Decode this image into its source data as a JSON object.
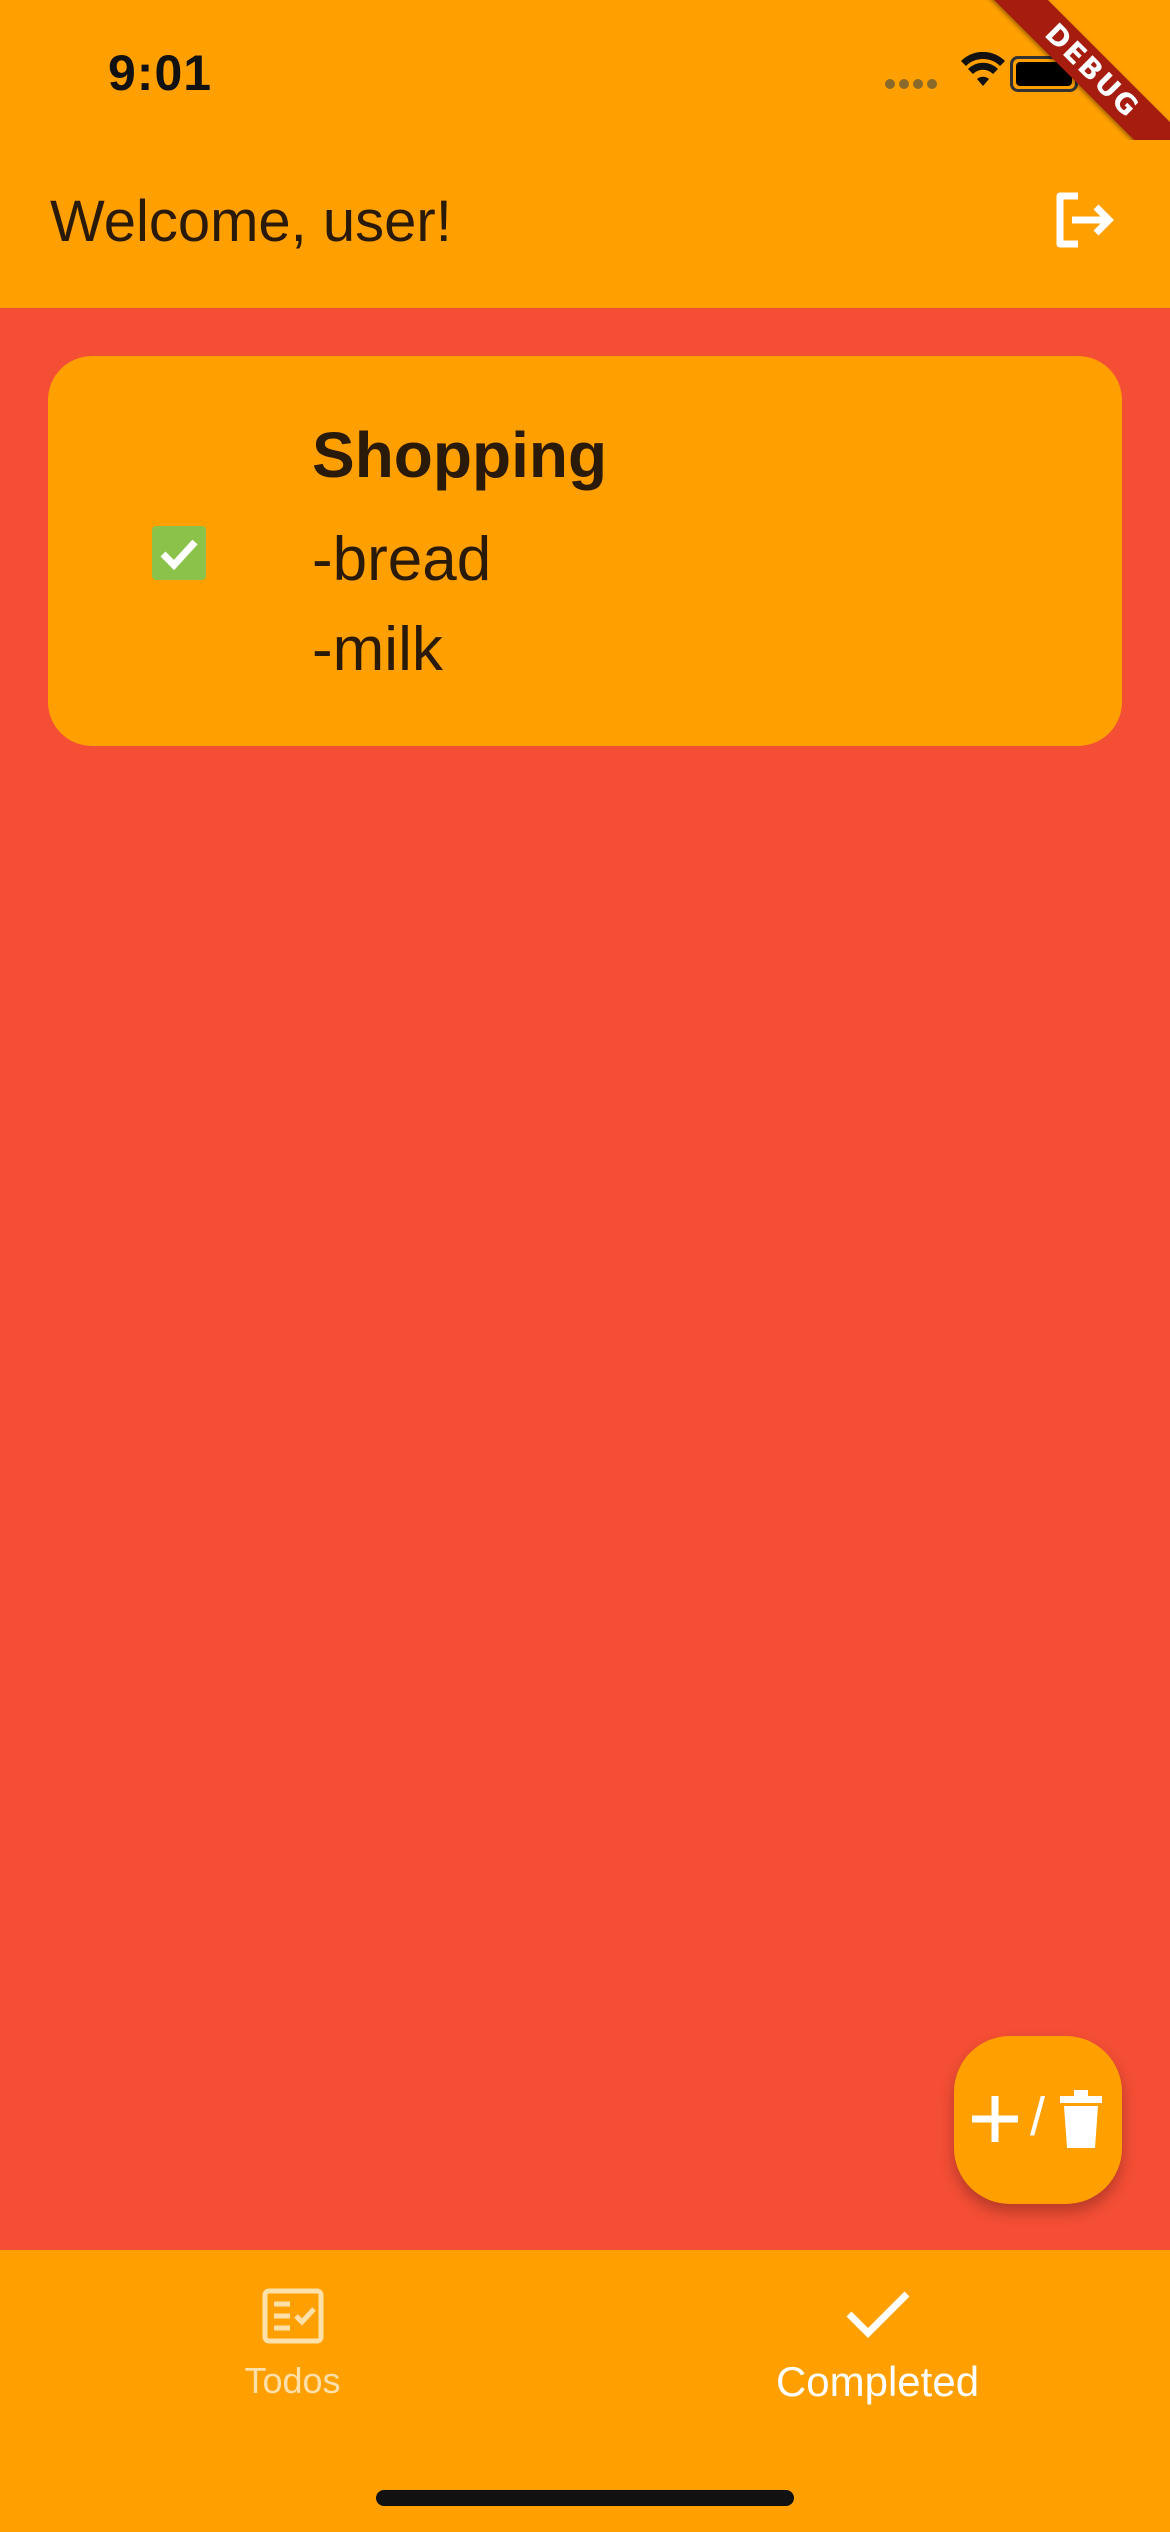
{
  "status_bar": {
    "time": "9:01"
  },
  "debug_banner": "DEBUG",
  "app_bar": {
    "title": "Welcome, user!",
    "logout_icon": "logout-icon"
  },
  "todos": [
    {
      "title": "Shopping",
      "lines": [
        "-bread",
        "-milk"
      ],
      "completed": true
    }
  ],
  "fab": {
    "separator": "/",
    "icons": [
      "add-icon",
      "trash-icon"
    ]
  },
  "bottom_nav": {
    "items": [
      {
        "label": "Todos",
        "icon": "checklist-icon",
        "selected": false
      },
      {
        "label": "Completed",
        "icon": "checkmark-icon",
        "selected": true
      }
    ]
  },
  "colors": {
    "background": "#F44E35",
    "accent": "#FF9F00",
    "checkbox": "#8BC34A",
    "debug_ribbon": "#A61D10"
  }
}
